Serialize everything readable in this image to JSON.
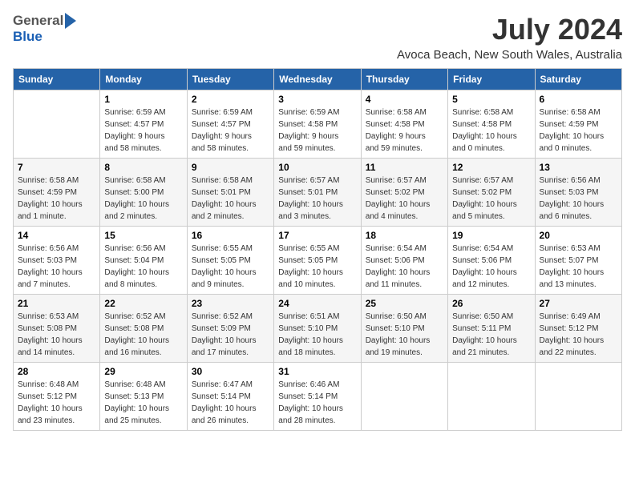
{
  "header": {
    "logo": {
      "general": "General",
      "blue": "Blue",
      "arrow_icon": "▶"
    },
    "title": "July 2024",
    "location": "Avoca Beach, New South Wales, Australia"
  },
  "calendar": {
    "days_of_week": [
      "Sunday",
      "Monday",
      "Tuesday",
      "Wednesday",
      "Thursday",
      "Friday",
      "Saturday"
    ],
    "weeks": [
      [
        {
          "day": "",
          "lines": []
        },
        {
          "day": "1",
          "lines": [
            "Sunrise: 6:59 AM",
            "Sunset: 4:57 PM",
            "Daylight: 9 hours",
            "and 58 minutes."
          ]
        },
        {
          "day": "2",
          "lines": [
            "Sunrise: 6:59 AM",
            "Sunset: 4:57 PM",
            "Daylight: 9 hours",
            "and 58 minutes."
          ]
        },
        {
          "day": "3",
          "lines": [
            "Sunrise: 6:59 AM",
            "Sunset: 4:58 PM",
            "Daylight: 9 hours",
            "and 59 minutes."
          ]
        },
        {
          "day": "4",
          "lines": [
            "Sunrise: 6:58 AM",
            "Sunset: 4:58 PM",
            "Daylight: 9 hours",
            "and 59 minutes."
          ]
        },
        {
          "day": "5",
          "lines": [
            "Sunrise: 6:58 AM",
            "Sunset: 4:58 PM",
            "Daylight: 10 hours",
            "and 0 minutes."
          ]
        },
        {
          "day": "6",
          "lines": [
            "Sunrise: 6:58 AM",
            "Sunset: 4:59 PM",
            "Daylight: 10 hours",
            "and 0 minutes."
          ]
        }
      ],
      [
        {
          "day": "7",
          "lines": [
            "Sunrise: 6:58 AM",
            "Sunset: 4:59 PM",
            "Daylight: 10 hours",
            "and 1 minute."
          ]
        },
        {
          "day": "8",
          "lines": [
            "Sunrise: 6:58 AM",
            "Sunset: 5:00 PM",
            "Daylight: 10 hours",
            "and 2 minutes."
          ]
        },
        {
          "day": "9",
          "lines": [
            "Sunrise: 6:58 AM",
            "Sunset: 5:01 PM",
            "Daylight: 10 hours",
            "and 2 minutes."
          ]
        },
        {
          "day": "10",
          "lines": [
            "Sunrise: 6:57 AM",
            "Sunset: 5:01 PM",
            "Daylight: 10 hours",
            "and 3 minutes."
          ]
        },
        {
          "day": "11",
          "lines": [
            "Sunrise: 6:57 AM",
            "Sunset: 5:02 PM",
            "Daylight: 10 hours",
            "and 4 minutes."
          ]
        },
        {
          "day": "12",
          "lines": [
            "Sunrise: 6:57 AM",
            "Sunset: 5:02 PM",
            "Daylight: 10 hours",
            "and 5 minutes."
          ]
        },
        {
          "day": "13",
          "lines": [
            "Sunrise: 6:56 AM",
            "Sunset: 5:03 PM",
            "Daylight: 10 hours",
            "and 6 minutes."
          ]
        }
      ],
      [
        {
          "day": "14",
          "lines": [
            "Sunrise: 6:56 AM",
            "Sunset: 5:03 PM",
            "Daylight: 10 hours",
            "and 7 minutes."
          ]
        },
        {
          "day": "15",
          "lines": [
            "Sunrise: 6:56 AM",
            "Sunset: 5:04 PM",
            "Daylight: 10 hours",
            "and 8 minutes."
          ]
        },
        {
          "day": "16",
          "lines": [
            "Sunrise: 6:55 AM",
            "Sunset: 5:05 PM",
            "Daylight: 10 hours",
            "and 9 minutes."
          ]
        },
        {
          "day": "17",
          "lines": [
            "Sunrise: 6:55 AM",
            "Sunset: 5:05 PM",
            "Daylight: 10 hours",
            "and 10 minutes."
          ]
        },
        {
          "day": "18",
          "lines": [
            "Sunrise: 6:54 AM",
            "Sunset: 5:06 PM",
            "Daylight: 10 hours",
            "and 11 minutes."
          ]
        },
        {
          "day": "19",
          "lines": [
            "Sunrise: 6:54 AM",
            "Sunset: 5:06 PM",
            "Daylight: 10 hours",
            "and 12 minutes."
          ]
        },
        {
          "day": "20",
          "lines": [
            "Sunrise: 6:53 AM",
            "Sunset: 5:07 PM",
            "Daylight: 10 hours",
            "and 13 minutes."
          ]
        }
      ],
      [
        {
          "day": "21",
          "lines": [
            "Sunrise: 6:53 AM",
            "Sunset: 5:08 PM",
            "Daylight: 10 hours",
            "and 14 minutes."
          ]
        },
        {
          "day": "22",
          "lines": [
            "Sunrise: 6:52 AM",
            "Sunset: 5:08 PM",
            "Daylight: 10 hours",
            "and 16 minutes."
          ]
        },
        {
          "day": "23",
          "lines": [
            "Sunrise: 6:52 AM",
            "Sunset: 5:09 PM",
            "Daylight: 10 hours",
            "and 17 minutes."
          ]
        },
        {
          "day": "24",
          "lines": [
            "Sunrise: 6:51 AM",
            "Sunset: 5:10 PM",
            "Daylight: 10 hours",
            "and 18 minutes."
          ]
        },
        {
          "day": "25",
          "lines": [
            "Sunrise: 6:50 AM",
            "Sunset: 5:10 PM",
            "Daylight: 10 hours",
            "and 19 minutes."
          ]
        },
        {
          "day": "26",
          "lines": [
            "Sunrise: 6:50 AM",
            "Sunset: 5:11 PM",
            "Daylight: 10 hours",
            "and 21 minutes."
          ]
        },
        {
          "day": "27",
          "lines": [
            "Sunrise: 6:49 AM",
            "Sunset: 5:12 PM",
            "Daylight: 10 hours",
            "and 22 minutes."
          ]
        }
      ],
      [
        {
          "day": "28",
          "lines": [
            "Sunrise: 6:48 AM",
            "Sunset: 5:12 PM",
            "Daylight: 10 hours",
            "and 23 minutes."
          ]
        },
        {
          "day": "29",
          "lines": [
            "Sunrise: 6:48 AM",
            "Sunset: 5:13 PM",
            "Daylight: 10 hours",
            "and 25 minutes."
          ]
        },
        {
          "day": "30",
          "lines": [
            "Sunrise: 6:47 AM",
            "Sunset: 5:14 PM",
            "Daylight: 10 hours",
            "and 26 minutes."
          ]
        },
        {
          "day": "31",
          "lines": [
            "Sunrise: 6:46 AM",
            "Sunset: 5:14 PM",
            "Daylight: 10 hours",
            "and 28 minutes."
          ]
        },
        {
          "day": "",
          "lines": []
        },
        {
          "day": "",
          "lines": []
        },
        {
          "day": "",
          "lines": []
        }
      ]
    ]
  }
}
